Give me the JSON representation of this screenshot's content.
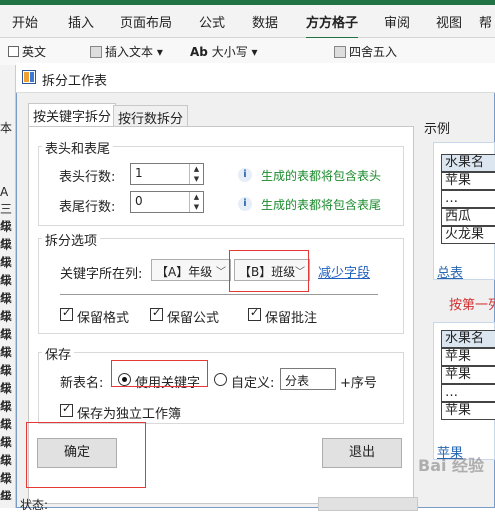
{
  "ribbon": {
    "tabs": [
      "开始",
      "插入",
      "页面布局",
      "公式",
      "数据",
      "方方格子",
      "审阅",
      "视图",
      "帮"
    ],
    "active_tab": "方方格子",
    "tools": {
      "english": "英文",
      "insert_text": "插入文本",
      "case_icon": "Ab",
      "case": "大小写",
      "round": "四舍五入"
    }
  },
  "background": {
    "left_label": "本",
    "col_a": "A",
    "rows": [
      "三级",
      "年级",
      "年级",
      "年级",
      "年级",
      "年级",
      "年级",
      "年级",
      "年级",
      "年级",
      "年级",
      "年级",
      "年级",
      "年级",
      "年级",
      "年级",
      "年级"
    ]
  },
  "dialog": {
    "title": "拆分工作表",
    "tabs": [
      "按关键字拆分",
      "按行数拆分"
    ],
    "header_footer": {
      "legend": "表头和表尾",
      "header_rows_label": "表头行数:",
      "header_rows_value": "1",
      "header_hint": "生成的表都将包含表头",
      "footer_rows_label": "表尾行数:",
      "footer_rows_value": "0",
      "footer_hint": "生成的表都将包含表尾"
    },
    "split_options": {
      "legend": "拆分选项",
      "key_col_label": "关键字所在列:",
      "combo1": "【A】年级",
      "combo2": "【B】班级",
      "reduce_link": "减少字段",
      "keep_format": "保留格式",
      "keep_formula": "保留公式",
      "keep_comment": "保留批注"
    },
    "save": {
      "legend": "保存",
      "new_name_label": "新表名:",
      "use_keyword": "使用关键字",
      "custom": "自定义:",
      "custom_value": "分表",
      "seq_suffix": "+序号",
      "save_as_workbook": "保存为独立工作簿"
    },
    "ok": "确定",
    "exit": "退出",
    "status_label": "状态:"
  },
  "example": {
    "label": "示例",
    "table1": [
      "水果名",
      "苹果",
      "…",
      "西瓜",
      "火龙果"
    ],
    "tab1": "总表",
    "note": "按第一列",
    "table2": [
      "水果名",
      "苹果",
      "苹果",
      "…",
      "苹果"
    ],
    "tab2": "苹果"
  },
  "watermark": "Bai 经验"
}
